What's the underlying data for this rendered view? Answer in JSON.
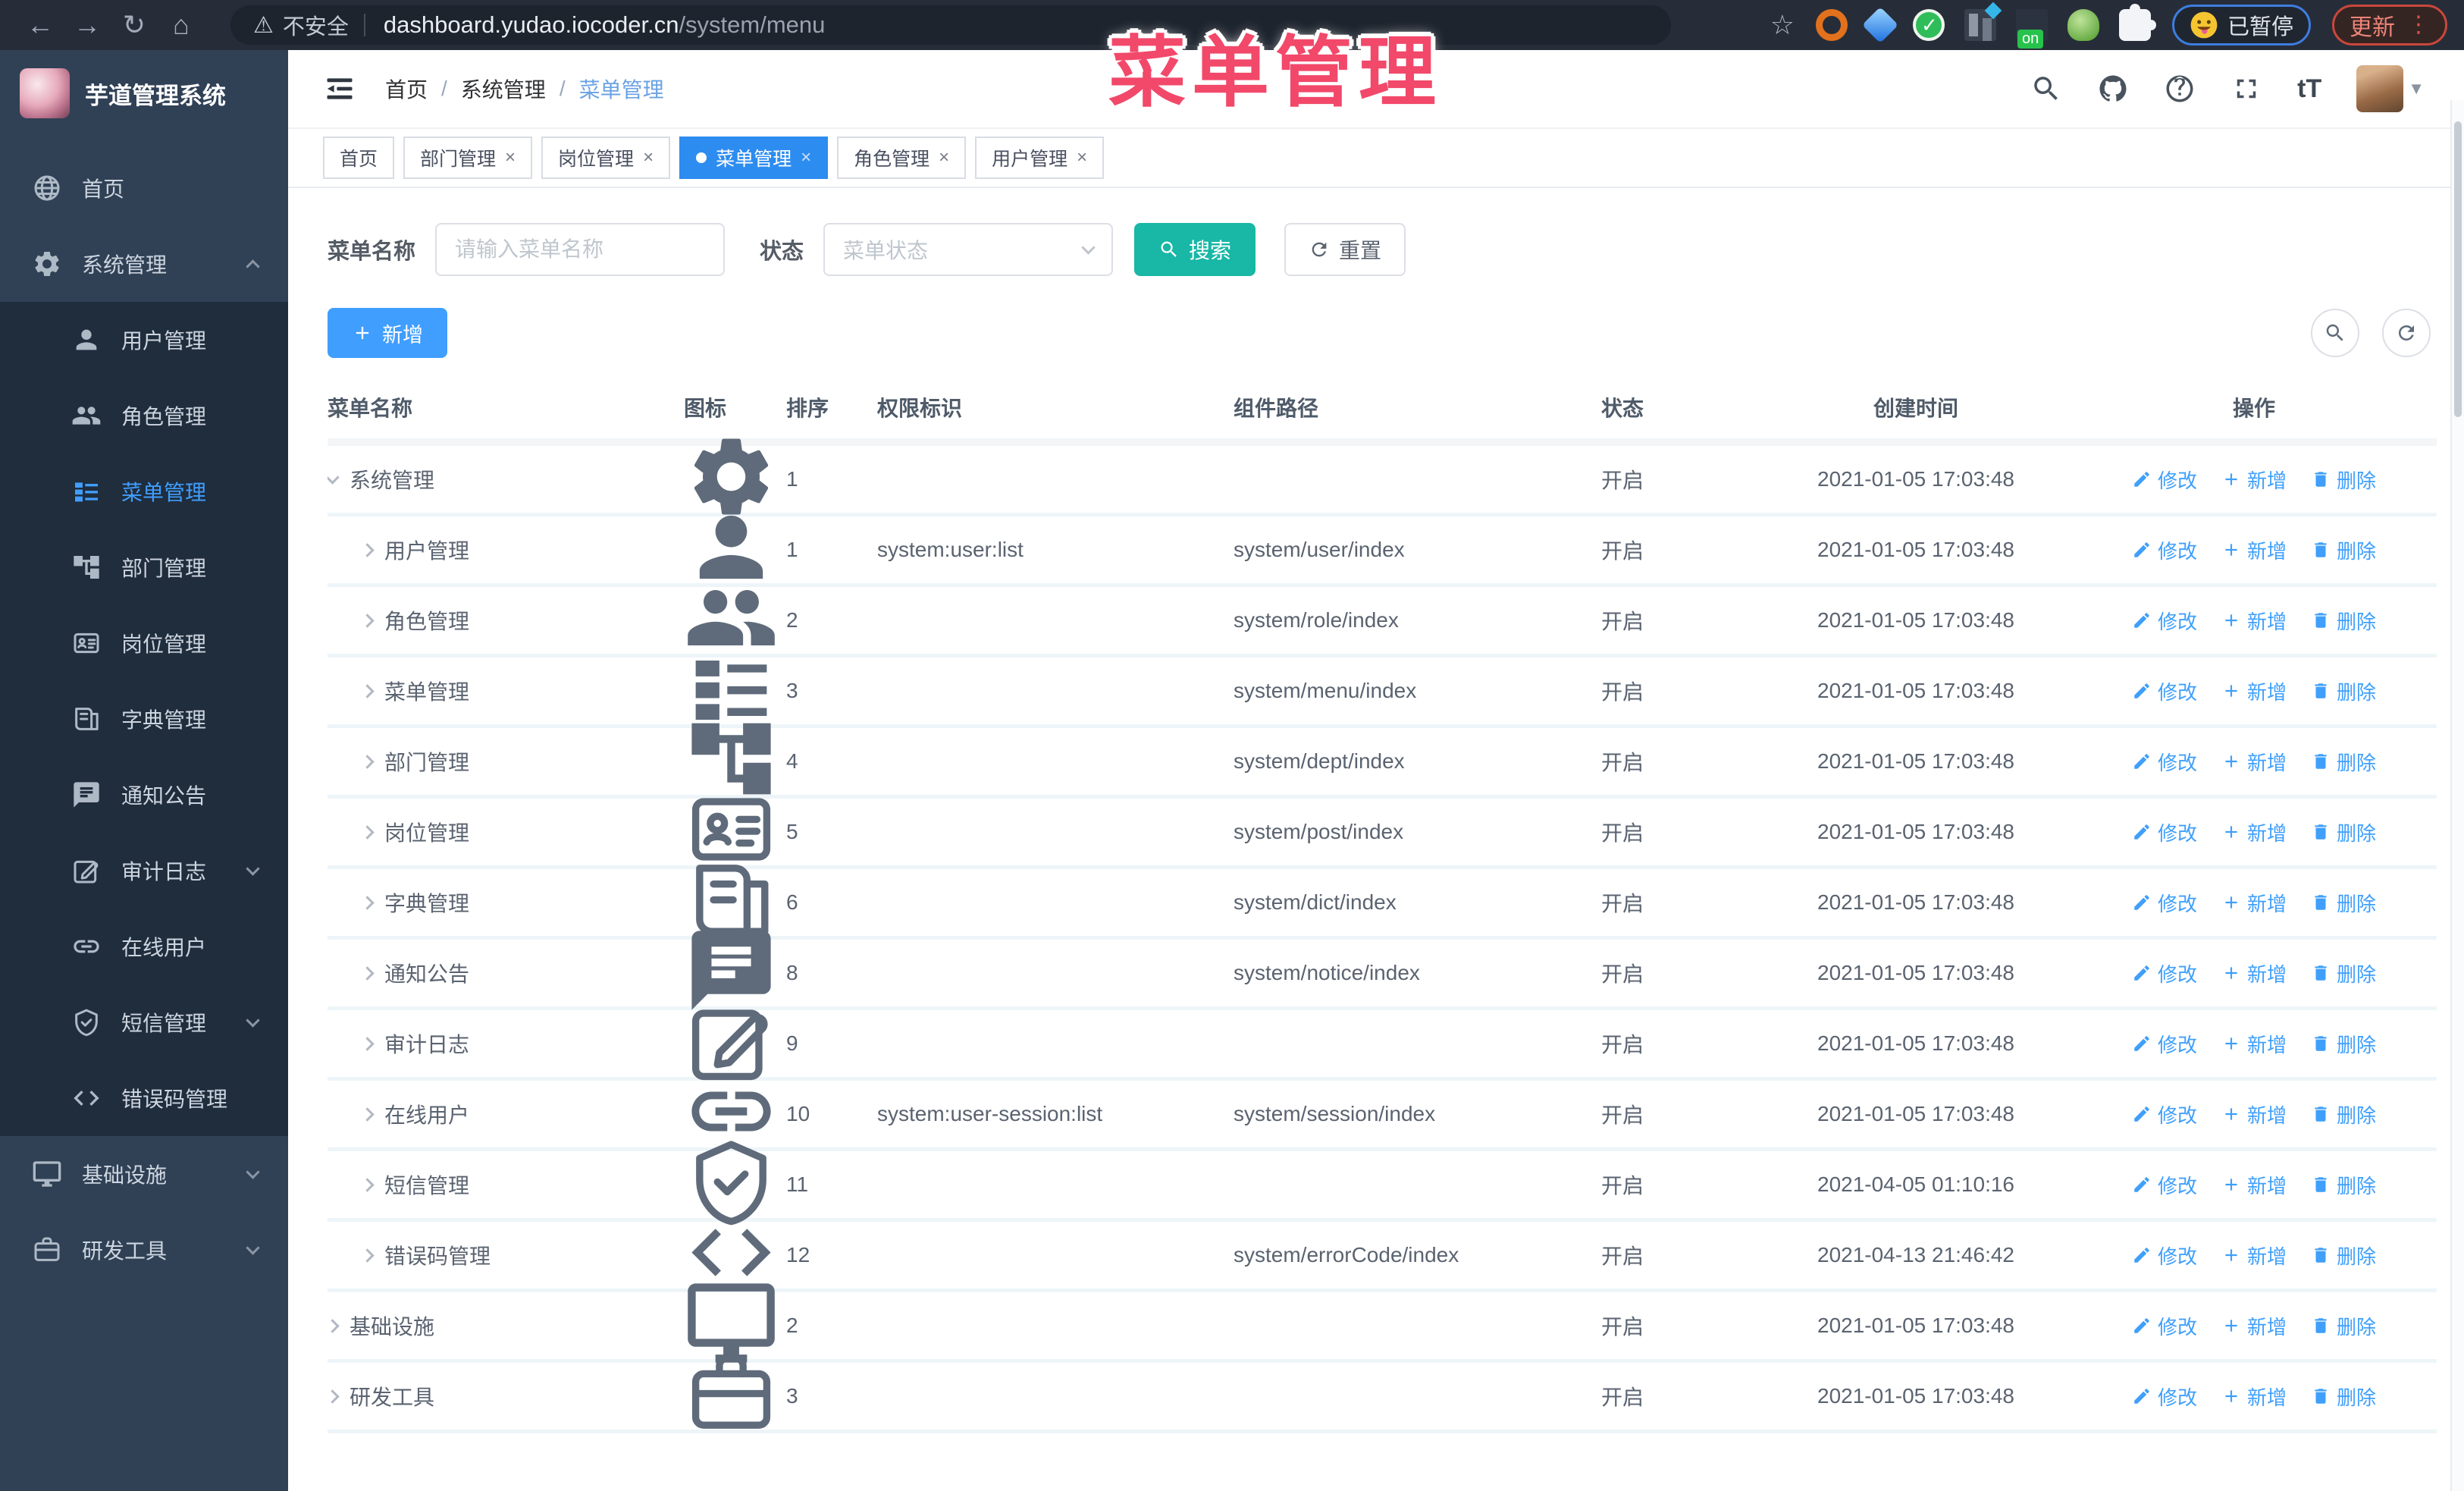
{
  "overlay_title": "菜单管理",
  "colors": {
    "primary": "#409eff",
    "active_tab": "#2d8cf0",
    "search_button": "#18b7a6",
    "overlay_text": "#f2486a",
    "sidebar_bg": "#304156",
    "submenu_bg": "#1f2d3d",
    "action_link": "#3f9ffb"
  },
  "browser": {
    "security_label": "不安全",
    "url_host": "dashboard.yudao.iocoder.cn",
    "url_path": "/system/menu",
    "paused_label": "已暂停",
    "update_label": "更新",
    "extension_icons": [
      "orange-ring",
      "blue-gem",
      "green-check",
      "columns",
      "on-badge",
      "green-animal",
      "puzzle"
    ]
  },
  "sidebar": {
    "app_title": "芋道管理系统",
    "items": [
      {
        "label": "首页",
        "icon": "globe",
        "level": 0
      },
      {
        "label": "系统管理",
        "icon": "gear",
        "level": 0,
        "arrow": "up"
      },
      {
        "label": "用户管理",
        "icon": "user",
        "level": 1
      },
      {
        "label": "角色管理",
        "icon": "users",
        "level": 1
      },
      {
        "label": "菜单管理",
        "icon": "tree-table",
        "level": 1,
        "active": true
      },
      {
        "label": "部门管理",
        "icon": "tree",
        "level": 1
      },
      {
        "label": "岗位管理",
        "icon": "badge",
        "level": 1
      },
      {
        "label": "字典管理",
        "icon": "book",
        "level": 1
      },
      {
        "label": "通知公告",
        "icon": "message",
        "level": 1
      },
      {
        "label": "审计日志",
        "icon": "edit",
        "level": 1,
        "arrow": "down"
      },
      {
        "label": "在线用户",
        "icon": "link",
        "level": 1
      },
      {
        "label": "短信管理",
        "icon": "shield",
        "level": 1,
        "arrow": "down"
      },
      {
        "label": "错误码管理",
        "icon": "code",
        "level": 1
      },
      {
        "label": "基础设施",
        "icon": "monitor",
        "level": 0,
        "arrow": "down"
      },
      {
        "label": "研发工具",
        "icon": "briefcase",
        "level": 0,
        "arrow": "down"
      }
    ]
  },
  "header": {
    "breadcrumb": [
      "首页",
      "系统管理",
      "菜单管理"
    ],
    "breadcrumb_separator": "/"
  },
  "tabs": [
    {
      "label": "首页",
      "closable": false,
      "active": false
    },
    {
      "label": "部门管理",
      "closable": true,
      "active": false
    },
    {
      "label": "岗位管理",
      "closable": true,
      "active": false
    },
    {
      "label": "菜单管理",
      "closable": true,
      "active": true
    },
    {
      "label": "角色管理",
      "closable": true,
      "active": false
    },
    {
      "label": "用户管理",
      "closable": true,
      "active": false
    }
  ],
  "filters": {
    "name_label": "菜单名称",
    "name_placeholder": "请输入菜单名称",
    "status_label": "状态",
    "status_placeholder": "菜单状态",
    "search_label": "搜索",
    "reset_label": "重置"
  },
  "toolbar": {
    "add_label": "新增"
  },
  "table": {
    "columns": [
      "菜单名称",
      "图标",
      "排序",
      "权限标识",
      "组件路径",
      "状态",
      "创建时间",
      "操作"
    ],
    "action_labels": [
      "修改",
      "新增",
      "删除"
    ],
    "rows": [
      {
        "name": "系统管理",
        "icon": "gear",
        "level": 0,
        "expanded": true,
        "sort": "1",
        "perm": "",
        "path": "",
        "status": "开启",
        "time": "2021-01-05 17:03:48"
      },
      {
        "name": "用户管理",
        "icon": "user",
        "level": 1,
        "expanded": false,
        "sort": "1",
        "perm": "system:user:list",
        "path": "system/user/index",
        "status": "开启",
        "time": "2021-01-05 17:03:48"
      },
      {
        "name": "角色管理",
        "icon": "users",
        "level": 1,
        "expanded": false,
        "sort": "2",
        "perm": "",
        "path": "system/role/index",
        "status": "开启",
        "time": "2021-01-05 17:03:48"
      },
      {
        "name": "菜单管理",
        "icon": "tree-table",
        "level": 1,
        "expanded": false,
        "sort": "3",
        "perm": "",
        "path": "system/menu/index",
        "status": "开启",
        "time": "2021-01-05 17:03:48"
      },
      {
        "name": "部门管理",
        "icon": "tree",
        "level": 1,
        "expanded": false,
        "sort": "4",
        "perm": "",
        "path": "system/dept/index",
        "status": "开启",
        "time": "2021-01-05 17:03:48"
      },
      {
        "name": "岗位管理",
        "icon": "badge",
        "level": 1,
        "expanded": false,
        "sort": "5",
        "perm": "",
        "path": "system/post/index",
        "status": "开启",
        "time": "2021-01-05 17:03:48"
      },
      {
        "name": "字典管理",
        "icon": "book",
        "level": 1,
        "expanded": false,
        "sort": "6",
        "perm": "",
        "path": "system/dict/index",
        "status": "开启",
        "time": "2021-01-05 17:03:48"
      },
      {
        "name": "通知公告",
        "icon": "message",
        "level": 1,
        "expanded": false,
        "sort": "8",
        "perm": "",
        "path": "system/notice/index",
        "status": "开启",
        "time": "2021-01-05 17:03:48"
      },
      {
        "name": "审计日志",
        "icon": "edit",
        "level": 1,
        "expanded": false,
        "sort": "9",
        "perm": "",
        "path": "",
        "status": "开启",
        "time": "2021-01-05 17:03:48"
      },
      {
        "name": "在线用户",
        "icon": "link",
        "level": 1,
        "expanded": false,
        "sort": "10",
        "perm": "system:user-session:list",
        "path": "system/session/index",
        "status": "开启",
        "time": "2021-01-05 17:03:48"
      },
      {
        "name": "短信管理",
        "icon": "shield",
        "level": 1,
        "expanded": false,
        "sort": "11",
        "perm": "",
        "path": "",
        "status": "开启",
        "time": "2021-04-05 01:10:16"
      },
      {
        "name": "错误码管理",
        "icon": "code",
        "level": 1,
        "expanded": false,
        "sort": "12",
        "perm": "",
        "path": "system/errorCode/index",
        "status": "开启",
        "time": "2021-04-13 21:46:42"
      },
      {
        "name": "基础设施",
        "icon": "monitor",
        "level": 0,
        "expanded": false,
        "sort": "2",
        "perm": "",
        "path": "",
        "status": "开启",
        "time": "2021-01-05 17:03:48"
      },
      {
        "name": "研发工具",
        "icon": "briefcase",
        "level": 0,
        "expanded": false,
        "sort": "3",
        "perm": "",
        "path": "",
        "status": "开启",
        "time": "2021-01-05 17:03:48"
      }
    ]
  }
}
